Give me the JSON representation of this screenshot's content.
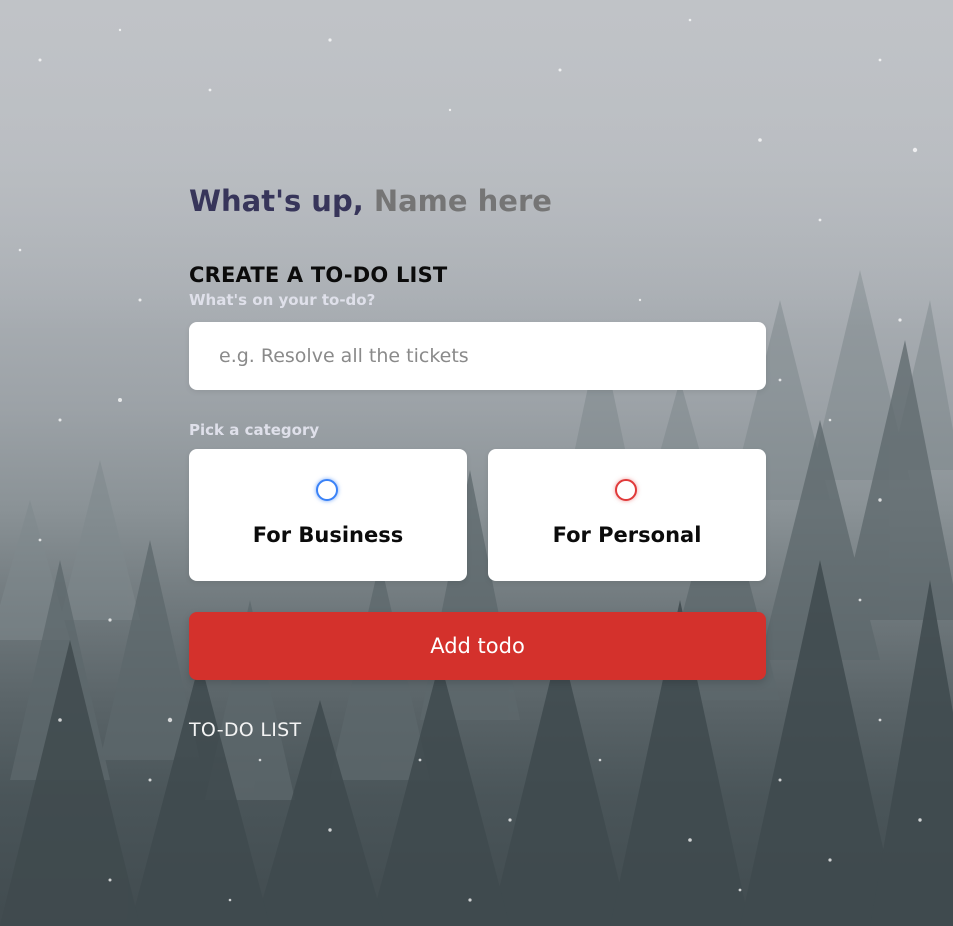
{
  "header": {
    "greeting_prefix": "What's up,",
    "name_placeholder": "Name here"
  },
  "create": {
    "title": "CREATE A TO-DO LIST",
    "prompt_label": "What's on your to-do?",
    "input_placeholder": "e.g. Resolve all the tickets",
    "category_label": "Pick a category",
    "categories": [
      {
        "label": "For Business",
        "color": "#3a82f7"
      },
      {
        "label": "For Personal",
        "color": "#e03a3a"
      }
    ],
    "submit_label": "Add todo"
  },
  "list": {
    "title": "TO-DO LIST"
  },
  "colors": {
    "accent": "#d4312c",
    "greeting": "#37355a"
  }
}
